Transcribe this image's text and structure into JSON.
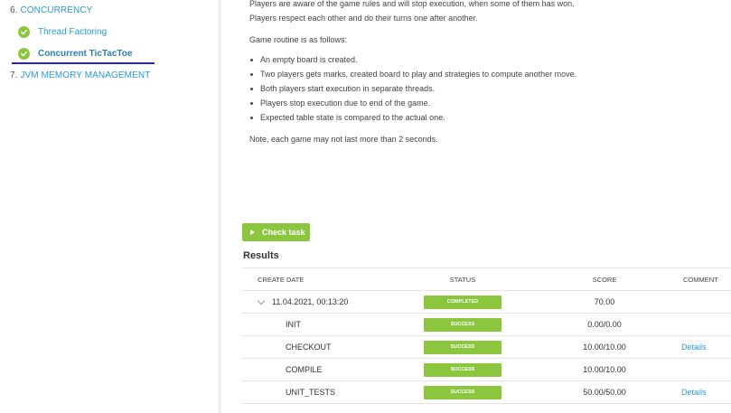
{
  "sidebar": {
    "section6": {
      "num": "6.",
      "label": "CONCURRENCY"
    },
    "items": [
      {
        "label": "Thread Factoring",
        "status": "completed"
      },
      {
        "label": "Concurrent TicTacToe",
        "status": "completed",
        "active": true
      }
    ],
    "section7": {
      "num": "7.",
      "label": "JVM MEMORY MANAGEMENT"
    }
  },
  "description": {
    "line1": "Players are aware of the game rules and will stop execution, when some of them has won.",
    "line2": "Players respect each other and do their turns one after another.",
    "routine_intro": "Game routine is as follows:",
    "bullets": [
      "An empty board is created.",
      "Two players gets marks, created board to play and strategies to compute another move.",
      "Both players start execution in separate threads.",
      "Players stop execution due to end of the game.",
      "Expected table state is compared to the actual one."
    ],
    "note": "Note, each game may not last more than 2 seconds."
  },
  "check_task_label": "Check task",
  "results": {
    "title": "Results",
    "headers": {
      "date": "CREATE DATE",
      "status": "STATUS",
      "score": "SCORE",
      "comment": "COMMENT"
    },
    "run": {
      "date": "11.04.2021, 00:13:20",
      "status": "COMPLETED",
      "score": "70.00",
      "comment": ""
    },
    "steps": [
      {
        "name": "INIT",
        "status": "SUCCESS",
        "score": "0.00/0.00",
        "comment": ""
      },
      {
        "name": "CHECKOUT",
        "status": "SUCCESS",
        "score": "10.00/10.00",
        "comment": "Details"
      },
      {
        "name": "COMPILE",
        "status": "SUCCESS",
        "score": "10.00/10.00",
        "comment": ""
      },
      {
        "name": "UNIT_TESTS",
        "status": "SUCCESS",
        "score": "50.00/50.00",
        "comment": "Details"
      }
    ]
  },
  "colors": {
    "accent_green": "#8cc63f",
    "link_blue": "#2a9bd8",
    "active_underline": "#2323c8"
  },
  "icons": {
    "completed": "check-circle-icon",
    "expand": "chevron-down-icon",
    "play": "play-icon"
  }
}
